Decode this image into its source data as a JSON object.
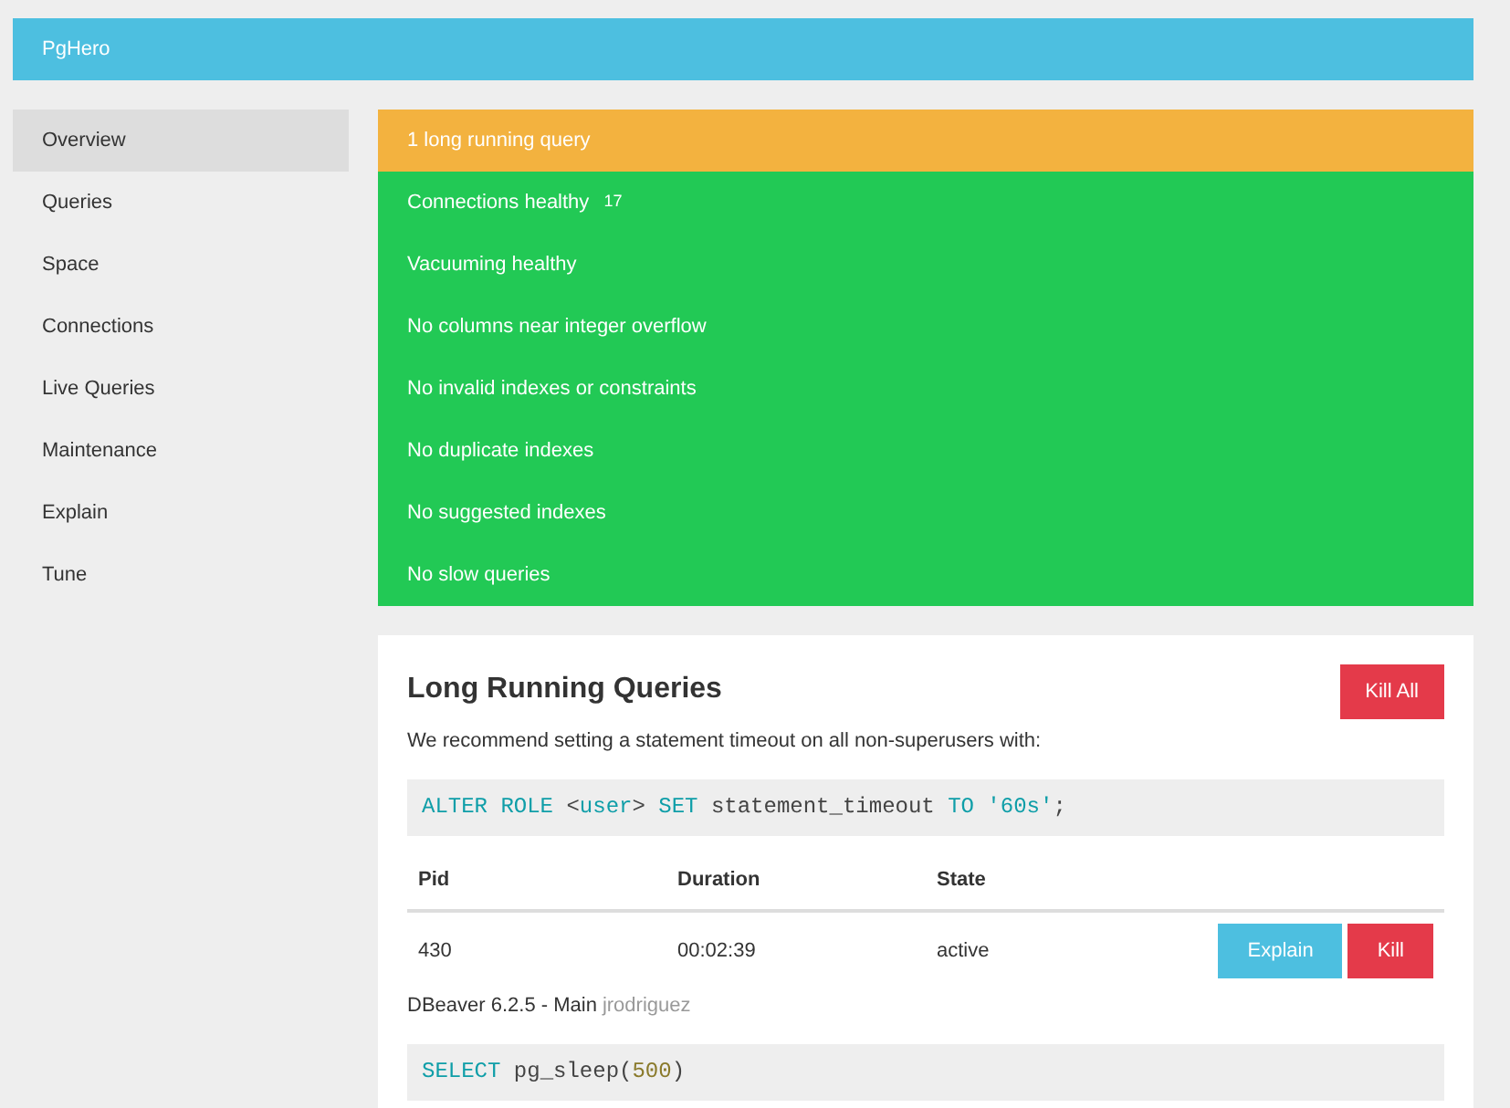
{
  "header": {
    "title": "PgHero"
  },
  "sidebar": {
    "items": [
      {
        "label": "Overview",
        "selected": true
      },
      {
        "label": "Queries",
        "selected": false
      },
      {
        "label": "Space",
        "selected": false
      },
      {
        "label": "Connections",
        "selected": false
      },
      {
        "label": "Live Queries",
        "selected": false
      },
      {
        "label": "Maintenance",
        "selected": false
      },
      {
        "label": "Explain",
        "selected": false
      },
      {
        "label": "Tune",
        "selected": false
      }
    ]
  },
  "checks": [
    {
      "label": "1 long running query",
      "color": "#f3b23f"
    },
    {
      "label": "Connections healthy",
      "color": "#22c955",
      "badge": "17"
    },
    {
      "label": "Vacuuming healthy",
      "color": "#22c955"
    },
    {
      "label": "No columns near integer overflow",
      "color": "#22c955"
    },
    {
      "label": "No invalid indexes or constraints",
      "color": "#22c955"
    },
    {
      "label": "No duplicate indexes",
      "color": "#22c955"
    },
    {
      "label": "No suggested indexes",
      "color": "#22c955"
    },
    {
      "label": "No slow queries",
      "color": "#22c955"
    }
  ],
  "panel": {
    "title": "Long Running Queries",
    "kill_all": "Kill All",
    "description": "We recommend setting a statement timeout on all non-superusers with:",
    "code": [
      {
        "text": "ALTER ROLE",
        "kind": "keyword"
      },
      {
        "text": " <",
        "kind": "plain"
      },
      {
        "text": "user",
        "kind": "keyword"
      },
      {
        "text": "> ",
        "kind": "plain"
      },
      {
        "text": "SET",
        "kind": "keyword"
      },
      {
        "text": " statement_timeout ",
        "kind": "plain"
      },
      {
        "text": "TO",
        "kind": "keyword"
      },
      {
        "text": " '60s'",
        "kind": "keyword"
      },
      {
        "text": ";",
        "kind": "plain"
      }
    ],
    "table": {
      "columns": [
        "Pid",
        "Duration",
        "State"
      ],
      "rows": [
        {
          "cells": [
            "430",
            "00:02:39",
            "active"
          ],
          "buttons": [
            "Explain",
            "Kill"
          ]
        }
      ]
    },
    "app": "DBeaver 6.2.5 - Main",
    "user": "jrodriguez",
    "query": [
      {
        "text": "SELECT",
        "kind": "keyword"
      },
      {
        "text": " pg_sleep(",
        "kind": "plain"
      },
      {
        "text": "500",
        "kind": "number"
      },
      {
        "text": ")",
        "kind": "plain"
      }
    ]
  }
}
